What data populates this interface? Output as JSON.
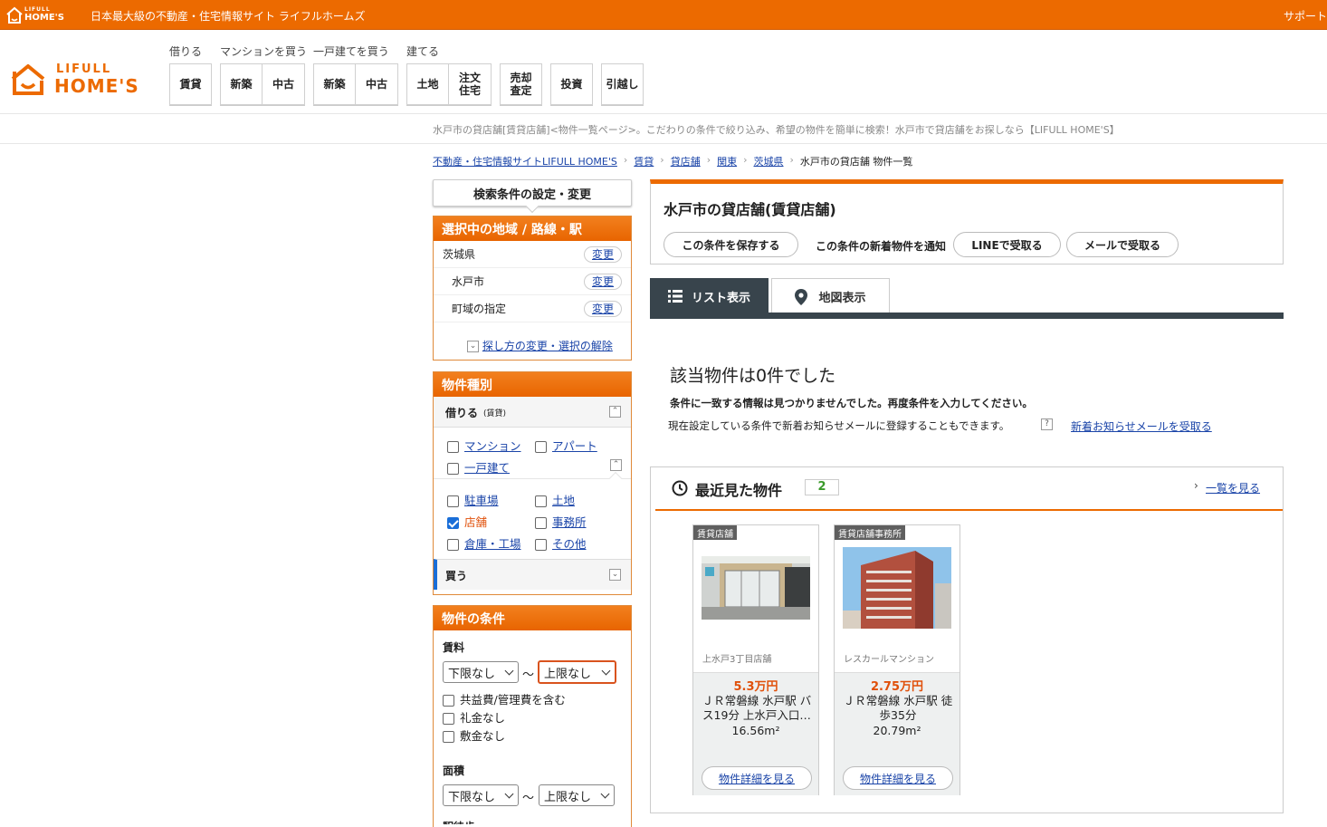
{
  "topbar": {
    "logo_small_1": "LIFULL",
    "logo_small_2": "HOME'S",
    "tagline": "日本最大級の不動産・住宅情報サイト ライフルホームズ",
    "support": "サポート"
  },
  "logo": {
    "line1": "LIFULL",
    "line2": "HOME'S"
  },
  "nav": {
    "groups": [
      {
        "label": "借りる",
        "buttons": [
          "賃貸"
        ]
      },
      {
        "label": "マンションを買う",
        "buttons": [
          "新築",
          "中古"
        ]
      },
      {
        "label": "一戸建てを買う",
        "buttons": [
          "新築",
          "中古"
        ]
      },
      {
        "label": "建てる",
        "buttons": [
          "土地",
          "注文\n住宅"
        ]
      },
      {
        "label": "",
        "buttons": [
          "売却\n査定"
        ]
      },
      {
        "label": "",
        "buttons": [
          "投資"
        ]
      },
      {
        "label": "",
        "buttons": [
          "引越し"
        ]
      }
    ]
  },
  "description": "水戸市の貸店舗[賃貸店舗]<物件一覧ページ>。こだわりの条件で絞り込み、希望の物件を簡単に検索！水戸市で貸店舗をお探しなら【LIFULL HOME'S】",
  "breadcrumb": {
    "items": [
      "不動産・住宅情報サイトLIFULL HOME'S",
      "賃貸",
      "貸店舗",
      "関東",
      "茨城県"
    ],
    "current": "水戸市の貸店舗 物件一覧"
  },
  "left": {
    "settings_button": "検索条件の設定・変更",
    "area_panel": {
      "title": "選択中の地域 / 路線・駅",
      "rows": [
        {
          "label": "茨城県",
          "button": "変更"
        },
        {
          "label": "水戸市",
          "button": "変更"
        },
        {
          "label": "町域の指定",
          "button": "変更"
        }
      ],
      "change_link": "探し方の変更・選択の解除"
    },
    "type_panel": {
      "title": "物件種別",
      "rent_label": "借りる",
      "rent_sub": "(賃貸)",
      "row1": [
        "マンション",
        "アパート"
      ],
      "row2": [
        "一戸建て"
      ],
      "row3": [
        "駐車場",
        "土地"
      ],
      "row4": [
        "店舗",
        "事務所"
      ],
      "row5": [
        "倉庫・工場",
        "その他"
      ],
      "buy_label": "買う"
    },
    "cond_panel": {
      "title": "物件の条件",
      "rent_label": "賃料",
      "rent_min": "下限なし",
      "rent_max": "上限なし",
      "tilde": "〜",
      "options": [
        "共益費/管理費を含む",
        "礼金なし",
        "敷金なし"
      ],
      "area_label": "面積",
      "area_min": "下限なし",
      "area_max": "上限なし",
      "next_label": "駅徒歩"
    }
  },
  "main": {
    "title": "水戸市の貸店舗(賃貸店舗)",
    "buttons": {
      "save": "この条件を保存する",
      "notify_label": "この条件の新着物件を通知",
      "line": "LINEで受取る",
      "mail": "メールで受取る"
    },
    "tabs": {
      "list": "リスト表示",
      "map": "地図表示"
    },
    "empty": {
      "heading": "該当物件は0件でした",
      "line1": "条件に一致する情報は見つかりませんでした。再度条件を入力してください。",
      "line2": "現在設定している条件で新着お知らせメールに登録することもできます。",
      "help": "?",
      "link": "新着お知らせメールを受取る"
    },
    "recent": {
      "title": "最近見た物件",
      "count": "2",
      "see_all": "一覧を見る",
      "cards": [
        {
          "tag": "賃貸店舗",
          "name": "上水戸3丁目店舗",
          "price": "5.3万円",
          "access": "ＪＲ常磐線 水戸駅 バス19分 上水戸入口…",
          "area": "16.56m²",
          "button": "物件詳細を見る"
        },
        {
          "tag": "賃貸店舗事務所",
          "name": "レスカールマンション",
          "price": "2.75万円",
          "access": "ＪＲ常磐線 水戸駅 徒歩35分",
          "area": "20.79m²",
          "button": "物件詳細を見る"
        }
      ]
    }
  },
  "colors": {
    "brand": "#ec6a00",
    "link": "#1a44a8",
    "tabbar": "#38444c",
    "price": "#e0500a"
  }
}
